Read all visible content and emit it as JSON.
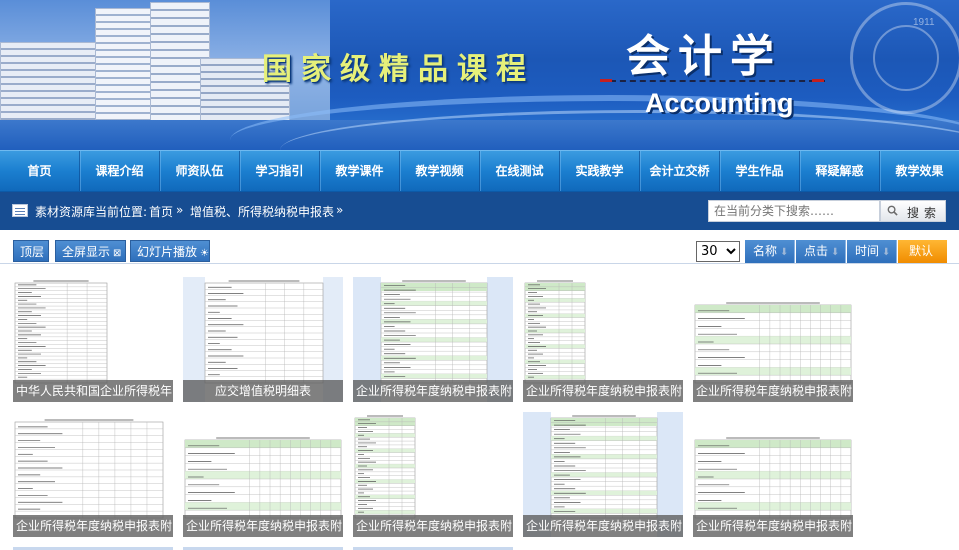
{
  "banner": {
    "course_title": "国家级精品课程",
    "subject": "会计学",
    "subject_en": "Accounting",
    "seal_year": "1911"
  },
  "nav": {
    "items": [
      "首页",
      "课程介绍",
      "师资队伍",
      "学习指引",
      "教学课件",
      "教学视频",
      "在线测试",
      "实践教学",
      "会计立交桥",
      "学生作品",
      "释疑解惑",
      "教学效果"
    ]
  },
  "location": {
    "prefix": "素材资源库当前位置:",
    "home": "首页",
    "separator": "»",
    "category": "增值税、所得税纳税申报表",
    "trailing_separator": "»"
  },
  "search": {
    "placeholder": "在当前分类下搜索……",
    "button_label": "搜索"
  },
  "toolbar": {
    "layer_label": "顶层",
    "fullscreen_label": "全屏显示",
    "fullscreen_symbol": "⊠",
    "slideshow_label": "幻灯片播放",
    "slideshow_symbol": "☀",
    "page_size": "30",
    "page_size_options": [
      "30"
    ],
    "sort_name": "名称",
    "sort_clicks": "点击",
    "sort_time": "时间",
    "sort_default": "默认",
    "sort_arrow": "⬇"
  },
  "thumbnails": [
    {
      "caption": "中华人民共和国企业所得税年",
      "style": "form-left"
    },
    {
      "caption": "应交增值税明细表",
      "style": "form-table"
    },
    {
      "caption": "企业所得税年度纳税申报表附",
      "style": "form-green"
    },
    {
      "caption": "企业所得税年度纳税申报表附",
      "style": "form-narrow"
    },
    {
      "caption": "企业所得税年度纳税申报表附",
      "style": "form-wide"
    },
    {
      "caption": "企业所得税年度纳税申报表附",
      "style": "form-grid"
    },
    {
      "caption": "企业所得税年度纳税申报表附",
      "style": "form-wide"
    },
    {
      "caption": "企业所得税年度纳税申报表附",
      "style": "form-narrow"
    },
    {
      "caption": "企业所得税年度纳税申报表附",
      "style": "form-green"
    },
    {
      "caption": "企业所得税年度纳税申报表附",
      "style": "form-wide"
    }
  ],
  "colors": {
    "banner_blue": "#1c57b6",
    "nav_blue": "#1b7fd0",
    "location_bar": "#174d92",
    "title_yellow": "#e6f07a",
    "sort_active": "#f08c00",
    "caption_bg": "#5c5c5c"
  },
  "icons": {
    "location": "list-icon",
    "search": "magnifier-icon",
    "sort": "down-arrow-icon"
  }
}
